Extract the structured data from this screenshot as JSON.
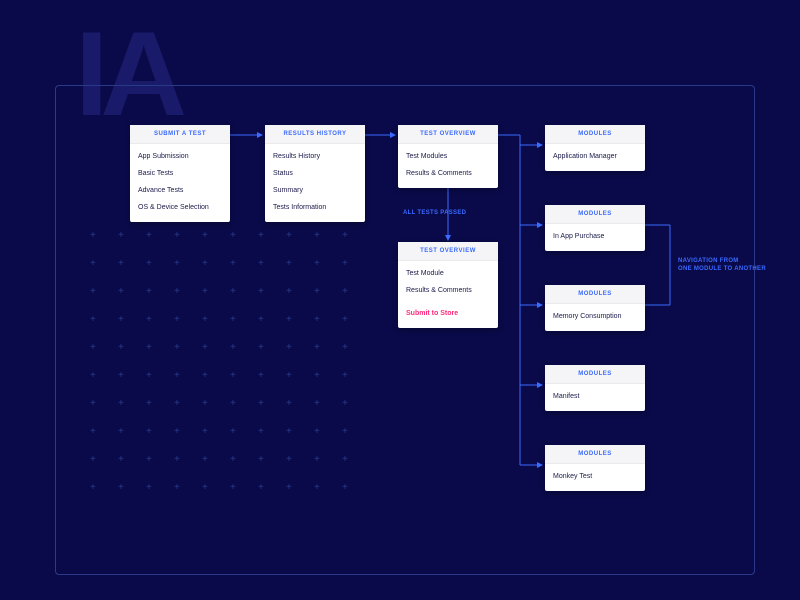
{
  "bgText": "IA",
  "cards": {
    "submit": {
      "header": "SUBMIT A TEST",
      "items": [
        "App Submission",
        "Basic Tests",
        "Advance Tests",
        "OS & Device Selection"
      ]
    },
    "results": {
      "header": "RESULTS HISTORY",
      "items": [
        "Results History",
        "Status",
        "Summary",
        "Tests Information"
      ]
    },
    "overview1": {
      "header": "TEST OVERVIEW",
      "items": [
        "Test Modules",
        "Results & Comments"
      ]
    },
    "overview2": {
      "header": "TEST OVERVIEW",
      "items": [
        "Test Module",
        "Results & Comments"
      ],
      "highlight": "Submit to Store"
    },
    "mod1": {
      "header": "MODULES",
      "items": [
        "Application Manager"
      ]
    },
    "mod2": {
      "header": "MODULES",
      "items": [
        "In App Purchase"
      ]
    },
    "mod3": {
      "header": "MODULES",
      "items": [
        "Memory Consumption"
      ]
    },
    "mod4": {
      "header": "MODULES",
      "items": [
        "Manifest"
      ]
    },
    "mod5": {
      "header": "MODULES",
      "items": [
        "Monkey Test"
      ]
    }
  },
  "labels": {
    "allPassed": "ALL TESTS PASSED",
    "nav1": "NAVIGATION FROM",
    "nav2": "ONE MODULE TO ANOTHER"
  }
}
